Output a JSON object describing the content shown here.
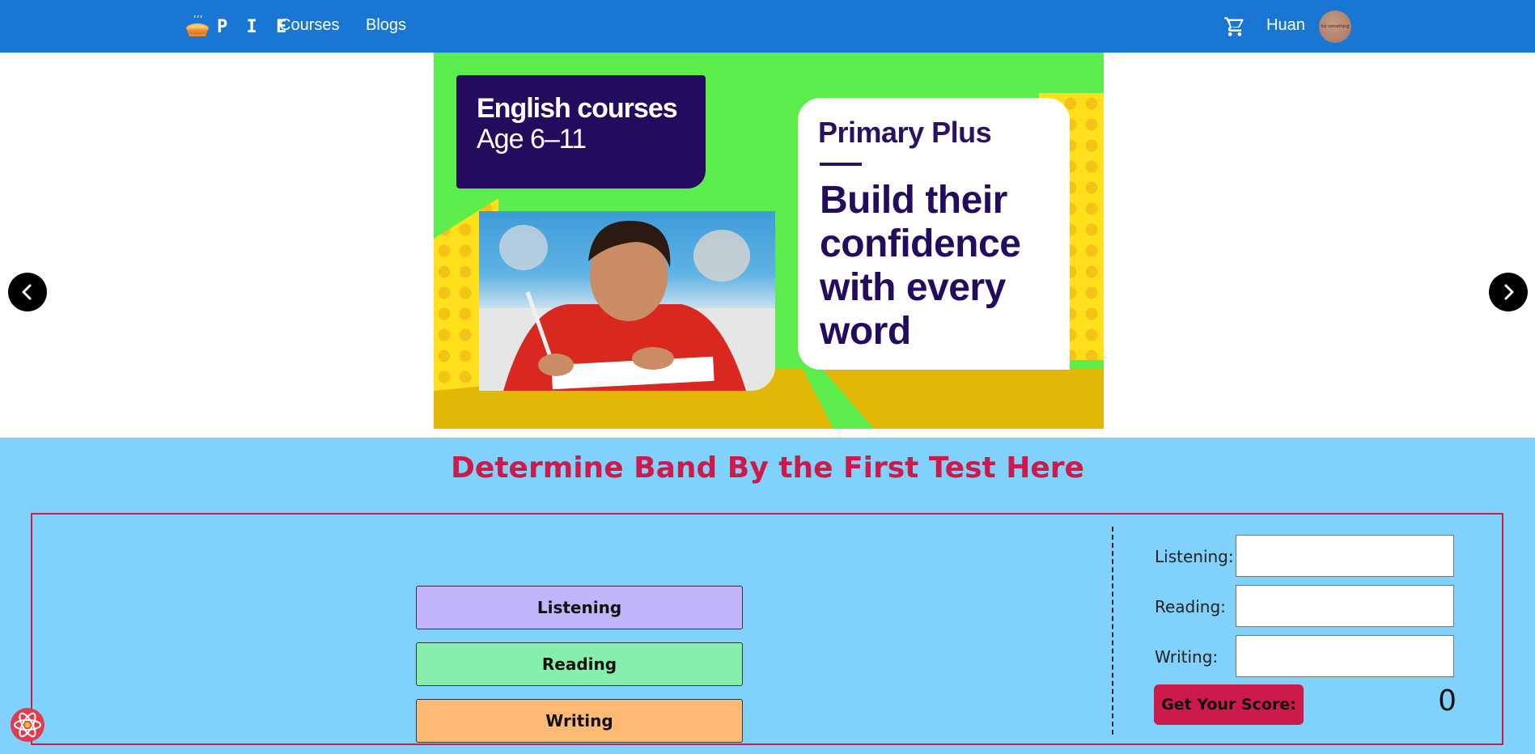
{
  "nav": {
    "brand": "P I E",
    "links": [
      "Courses",
      "Blogs"
    ],
    "user_name": "Huan",
    "avatar_text": "his something",
    "bg_color": "#1976d2"
  },
  "carousel": {
    "slide": {
      "age_title": "English courses",
      "age_sub": "Age 6–11",
      "brand": "Primary Plus",
      "slogan": "Build their confidence with every word"
    },
    "slide_count": 8,
    "active_index": 2,
    "prev_icon": "chevron-left-icon",
    "next_icon": "chevron-right-icon"
  },
  "test": {
    "heading": "Determine Band By the First Test Here",
    "buttons": [
      {
        "label": "Listening",
        "color": "#c3b5fb"
      },
      {
        "label": "Reading",
        "color": "#86efac"
      },
      {
        "label": "Writing",
        "color": "#fdba74"
      }
    ],
    "fields": [
      {
        "label": "Listening:",
        "value": ""
      },
      {
        "label": "Reading:",
        "value": ""
      },
      {
        "label": "Writing:",
        "value": ""
      }
    ],
    "score_button": "Get Your Score:",
    "score_value": "0",
    "accent_color": "#cc1a4b",
    "section_bg": "#80d1fb"
  }
}
